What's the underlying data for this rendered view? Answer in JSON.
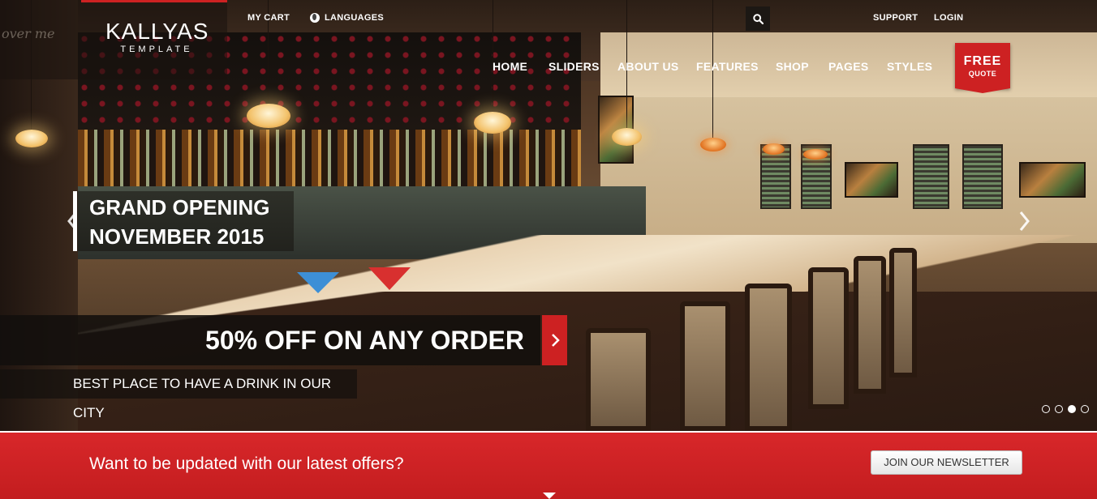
{
  "header": {
    "logo_main": "KALLYAS",
    "logo_sub": "TEMPLATE",
    "scribble": "over me",
    "top_links": {
      "cart": "MY CART",
      "languages": "LANGUAGES",
      "support": "SUPPORT",
      "login": "LOGIN"
    },
    "nav": [
      "HOME",
      "SLIDERS",
      "ABOUT US",
      "FEATURES",
      "SHOP",
      "PAGES",
      "STYLES"
    ],
    "free_quote": {
      "line1": "FREE",
      "line2": "QUOTE"
    }
  },
  "slider": {
    "title_line1": "GRAND OPENING",
    "title_line2": "NOVEMBER 2015",
    "offer": "50% OFF ON ANY ORDER",
    "subtitle": "BEST PLACE TO HAVE A DRINK IN OUR CITY",
    "bullets": 4,
    "active_bullet": 3
  },
  "newsletter": {
    "text": "Want to be updated with our latest offers?",
    "button": "JOIN OUR NEWSLETTER"
  },
  "colors": {
    "accent": "#cd2122",
    "dark": "#1c1814"
  },
  "icons": [
    "search-icon",
    "globe-icon",
    "chevron-left-icon",
    "chevron-right-icon",
    "arrow-right-icon"
  ]
}
